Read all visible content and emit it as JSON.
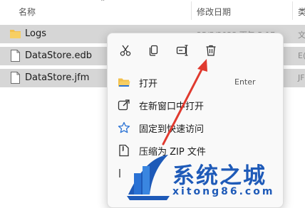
{
  "header": {
    "col_name": "名称",
    "col_date": "修改日期",
    "col_type": "类"
  },
  "files": [
    {
      "name": "Logs",
      "date": "25/5/2023 下午 5:17",
      "type": "文",
      "icon": "folder-icon"
    },
    {
      "name": "DataStore.edb",
      "date": "",
      "type": "E(",
      "icon": "file-icon"
    },
    {
      "name": "DataStore.jfm",
      "date": "",
      "type": "JF",
      "icon": "file-icon"
    }
  ],
  "context_menu": {
    "toolbar": [
      "cut-icon",
      "copy-icon",
      "rename-icon",
      "delete-icon"
    ],
    "items": [
      {
        "label": "打开",
        "shortcut": "Enter",
        "icon": "folder-open-icon"
      },
      {
        "label": "在新窗口中打开",
        "shortcut": "",
        "icon": "new-window-icon"
      },
      {
        "label": "固定到快速访问",
        "shortcut": "",
        "icon": "star-icon"
      },
      {
        "label": "压缩为 ZIP 文件",
        "shortcut": "",
        "icon": "zip-icon"
      }
    ]
  },
  "colors": {
    "accent": "#1e5ab8",
    "selection": "#d6d6d6",
    "annotation_arrow": "#e03a2f"
  },
  "watermark": {
    "title": "系统之城",
    "url": "xitong86.com"
  }
}
